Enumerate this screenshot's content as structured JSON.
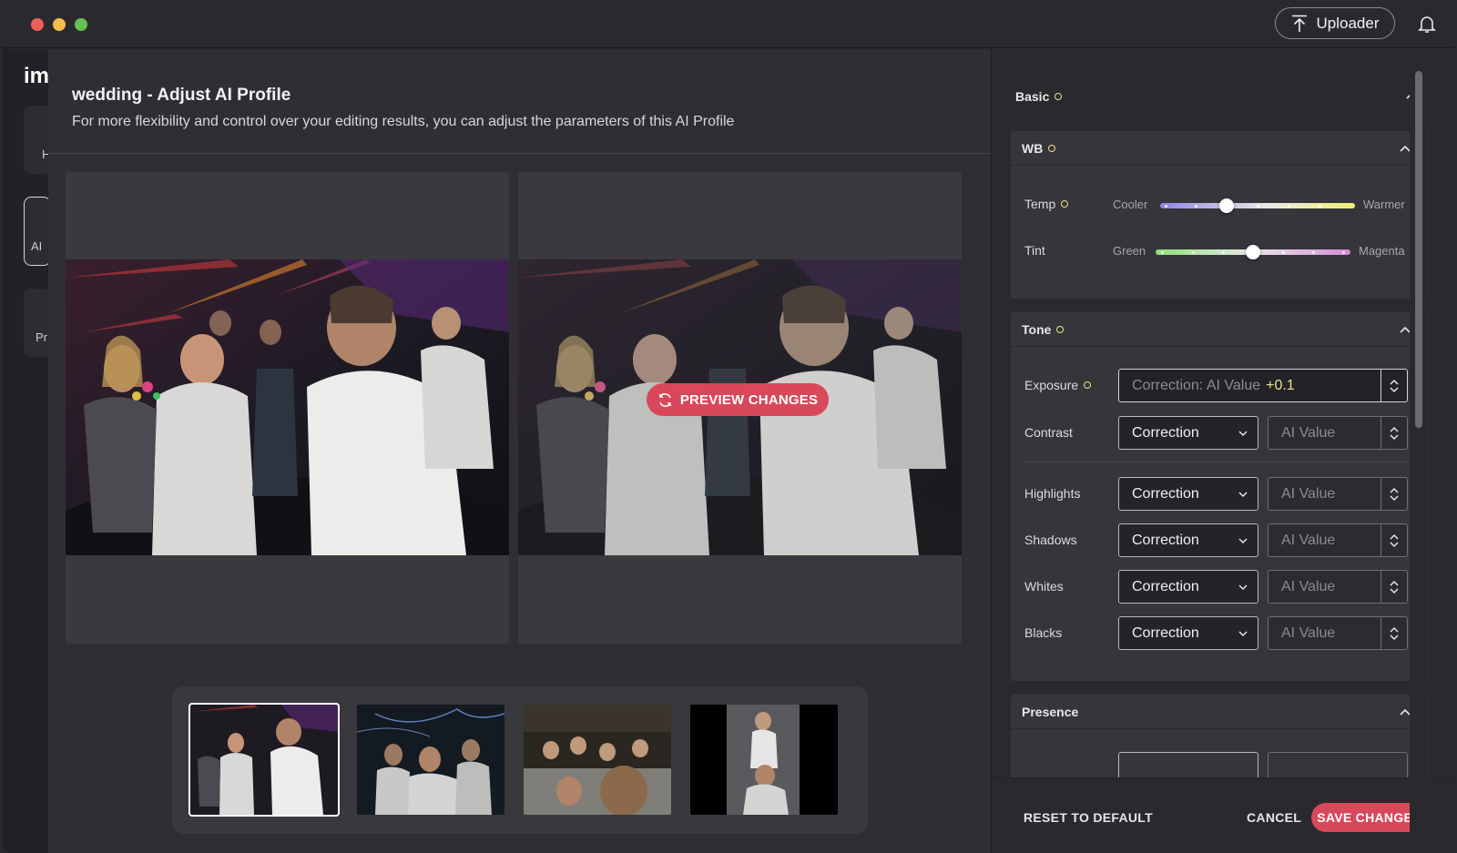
{
  "titlebar": {
    "uploader_label": "Uploader",
    "traffic_colors": [
      "#ed5f57",
      "#f5bd4f",
      "#61c454"
    ]
  },
  "sidebar": {
    "logo": "im",
    "cards": [
      {
        "label": "H"
      },
      {
        "label": "AI"
      },
      {
        "label": "Pr"
      }
    ]
  },
  "header": {
    "title": "wedding - Adjust AI Profile",
    "subtitle": "For more flexibility and control over your editing results, you can adjust the parameters of this AI Profile"
  },
  "preview": {
    "button_label": "PREVIEW CHANGES",
    "accent": "#d9485a"
  },
  "thumbnails": [
    {
      "name": "thumb-1",
      "selected": true
    },
    {
      "name": "thumb-2",
      "selected": false
    },
    {
      "name": "thumb-3",
      "selected": false
    },
    {
      "name": "thumb-4",
      "selected": false
    }
  ],
  "panel": {
    "basic": {
      "title": "Basic"
    },
    "wb": {
      "title": "WB",
      "temp": {
        "label": "Temp",
        "left": "Cooler",
        "right": "Warmer",
        "value_fraction": 0.34
      },
      "tint": {
        "label": "Tint",
        "left": "Green",
        "right": "Magenta",
        "value_fraction": 0.5
      }
    },
    "tone": {
      "title": "Tone",
      "exposure": {
        "label": "Exposure",
        "placeholder": "Correction: AI Value",
        "value": "+0.1"
      },
      "rows": [
        {
          "label": "Contrast",
          "mode": "Correction",
          "value": "AI Value"
        },
        {
          "label": "Highlights",
          "mode": "Correction",
          "value": "AI Value"
        },
        {
          "label": "Shadows",
          "mode": "Correction",
          "value": "AI Value"
        },
        {
          "label": "Whites",
          "mode": "Correction",
          "value": "AI Value"
        },
        {
          "label": "Blacks",
          "mode": "Correction",
          "value": "AI Value"
        }
      ]
    },
    "presence": {
      "title": "Presence"
    }
  },
  "footer": {
    "reset_label": "RESET TO DEFAULT",
    "cancel_label": "CANCEL",
    "save_label": "SAVE CHANGES"
  }
}
